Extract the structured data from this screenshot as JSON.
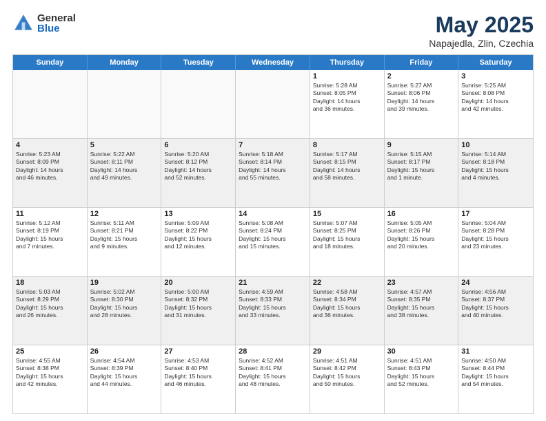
{
  "logo": {
    "general": "General",
    "blue": "Blue"
  },
  "title": "May 2025",
  "subtitle": "Napajedla, Zlin, Czechia",
  "header_days": [
    "Sunday",
    "Monday",
    "Tuesday",
    "Wednesday",
    "Thursday",
    "Friday",
    "Saturday"
  ],
  "weeks": [
    [
      {
        "day": "",
        "info": "",
        "empty": true
      },
      {
        "day": "",
        "info": "",
        "empty": true
      },
      {
        "day": "",
        "info": "",
        "empty": true
      },
      {
        "day": "",
        "info": "",
        "empty": true
      },
      {
        "day": "1",
        "info": "Sunrise: 5:28 AM\nSunset: 8:05 PM\nDaylight: 14 hours\nand 36 minutes."
      },
      {
        "day": "2",
        "info": "Sunrise: 5:27 AM\nSunset: 8:06 PM\nDaylight: 14 hours\nand 39 minutes."
      },
      {
        "day": "3",
        "info": "Sunrise: 5:25 AM\nSunset: 8:08 PM\nDaylight: 14 hours\nand 42 minutes."
      }
    ],
    [
      {
        "day": "4",
        "info": "Sunrise: 5:23 AM\nSunset: 8:09 PM\nDaylight: 14 hours\nand 46 minutes."
      },
      {
        "day": "5",
        "info": "Sunrise: 5:22 AM\nSunset: 8:11 PM\nDaylight: 14 hours\nand 49 minutes."
      },
      {
        "day": "6",
        "info": "Sunrise: 5:20 AM\nSunset: 8:12 PM\nDaylight: 14 hours\nand 52 minutes."
      },
      {
        "day": "7",
        "info": "Sunrise: 5:18 AM\nSunset: 8:14 PM\nDaylight: 14 hours\nand 55 minutes."
      },
      {
        "day": "8",
        "info": "Sunrise: 5:17 AM\nSunset: 8:15 PM\nDaylight: 14 hours\nand 58 minutes."
      },
      {
        "day": "9",
        "info": "Sunrise: 5:15 AM\nSunset: 8:17 PM\nDaylight: 15 hours\nand 1 minute."
      },
      {
        "day": "10",
        "info": "Sunrise: 5:14 AM\nSunset: 8:18 PM\nDaylight: 15 hours\nand 4 minutes."
      }
    ],
    [
      {
        "day": "11",
        "info": "Sunrise: 5:12 AM\nSunset: 8:19 PM\nDaylight: 15 hours\nand 7 minutes."
      },
      {
        "day": "12",
        "info": "Sunrise: 5:11 AM\nSunset: 8:21 PM\nDaylight: 15 hours\nand 9 minutes."
      },
      {
        "day": "13",
        "info": "Sunrise: 5:09 AM\nSunset: 8:22 PM\nDaylight: 15 hours\nand 12 minutes."
      },
      {
        "day": "14",
        "info": "Sunrise: 5:08 AM\nSunset: 8:24 PM\nDaylight: 15 hours\nand 15 minutes."
      },
      {
        "day": "15",
        "info": "Sunrise: 5:07 AM\nSunset: 8:25 PM\nDaylight: 15 hours\nand 18 minutes."
      },
      {
        "day": "16",
        "info": "Sunrise: 5:05 AM\nSunset: 8:26 PM\nDaylight: 15 hours\nand 20 minutes."
      },
      {
        "day": "17",
        "info": "Sunrise: 5:04 AM\nSunset: 8:28 PM\nDaylight: 15 hours\nand 23 minutes."
      }
    ],
    [
      {
        "day": "18",
        "info": "Sunrise: 5:03 AM\nSunset: 8:29 PM\nDaylight: 15 hours\nand 26 minutes."
      },
      {
        "day": "19",
        "info": "Sunrise: 5:02 AM\nSunset: 8:30 PM\nDaylight: 15 hours\nand 28 minutes."
      },
      {
        "day": "20",
        "info": "Sunrise: 5:00 AM\nSunset: 8:32 PM\nDaylight: 15 hours\nand 31 minutes."
      },
      {
        "day": "21",
        "info": "Sunrise: 4:59 AM\nSunset: 8:33 PM\nDaylight: 15 hours\nand 33 minutes."
      },
      {
        "day": "22",
        "info": "Sunrise: 4:58 AM\nSunset: 8:34 PM\nDaylight: 15 hours\nand 36 minutes."
      },
      {
        "day": "23",
        "info": "Sunrise: 4:57 AM\nSunset: 8:35 PM\nDaylight: 15 hours\nand 38 minutes."
      },
      {
        "day": "24",
        "info": "Sunrise: 4:56 AM\nSunset: 8:37 PM\nDaylight: 15 hours\nand 40 minutes."
      }
    ],
    [
      {
        "day": "25",
        "info": "Sunrise: 4:55 AM\nSunset: 8:38 PM\nDaylight: 15 hours\nand 42 minutes."
      },
      {
        "day": "26",
        "info": "Sunrise: 4:54 AM\nSunset: 8:39 PM\nDaylight: 15 hours\nand 44 minutes."
      },
      {
        "day": "27",
        "info": "Sunrise: 4:53 AM\nSunset: 8:40 PM\nDaylight: 15 hours\nand 46 minutes."
      },
      {
        "day": "28",
        "info": "Sunrise: 4:52 AM\nSunset: 8:41 PM\nDaylight: 15 hours\nand 48 minutes."
      },
      {
        "day": "29",
        "info": "Sunrise: 4:51 AM\nSunset: 8:42 PM\nDaylight: 15 hours\nand 50 minutes."
      },
      {
        "day": "30",
        "info": "Sunrise: 4:51 AM\nSunset: 8:43 PM\nDaylight: 15 hours\nand 52 minutes."
      },
      {
        "day": "31",
        "info": "Sunrise: 4:50 AM\nSunset: 8:44 PM\nDaylight: 15 hours\nand 54 minutes."
      }
    ]
  ]
}
